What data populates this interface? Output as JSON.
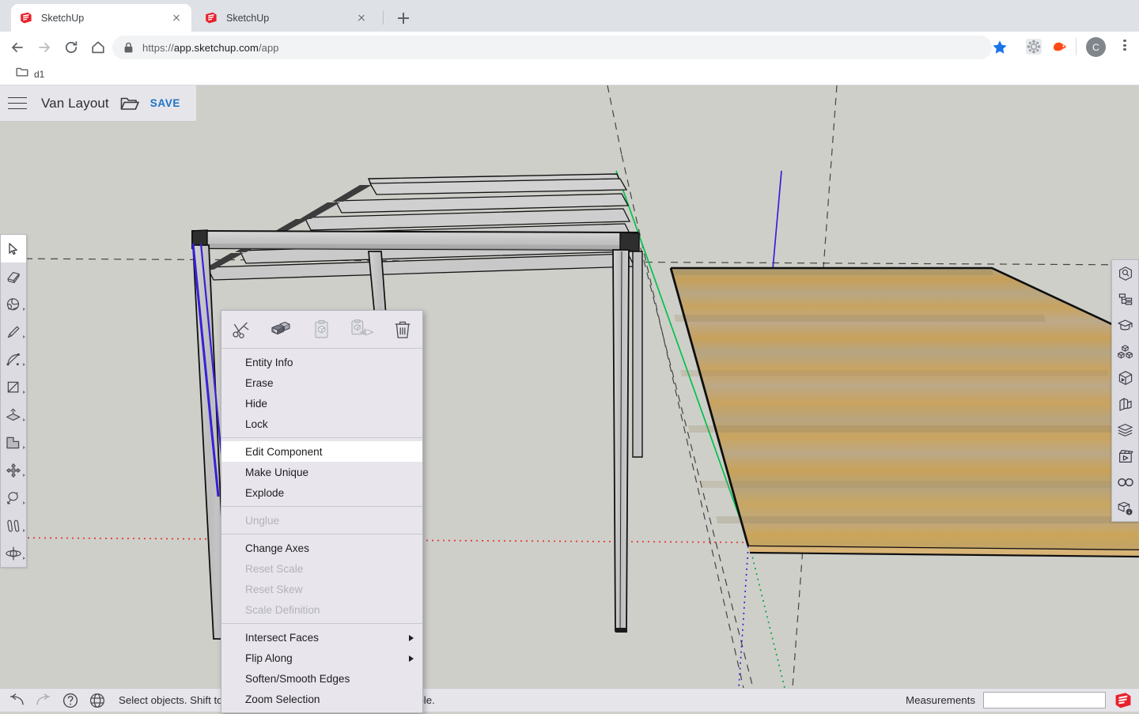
{
  "browser": {
    "tabs": [
      {
        "title": "SketchUp",
        "active": true,
        "favicon": "sketchup-icon"
      },
      {
        "title": "SketchUp",
        "active": false,
        "favicon": "sketchup-icon"
      }
    ],
    "new_tab_label": "+",
    "nav": {
      "back": "back-arrow",
      "forward": "forward-arrow",
      "reload": "reload-icon",
      "home": "home-icon"
    },
    "omnibox": {
      "lock": "lock-icon",
      "url_secure": "https://",
      "url_domain": "app.sketchup.com",
      "url_path": "/app",
      "full_url": "https://app.sketchup.com/app"
    },
    "toolbar_right": {
      "bookmark_star": "star-icon",
      "extension_puzzle": "extension-icon",
      "extension_accent": "extension-icon",
      "profile_initial": "C",
      "menu": "kebab-menu-icon"
    },
    "bookmarks": [
      {
        "label": "d1",
        "icon": "folder-icon"
      }
    ]
  },
  "app_header": {
    "menu_icon": "hamburger-icon",
    "document_title": "Van Layout",
    "folder_icon": "folder-open-icon",
    "save_label": "SAVE"
  },
  "left_toolbar": {
    "tools": [
      {
        "name": "select-tool",
        "icon": "cursor-arrow-icon",
        "active": true,
        "has_flyout": false
      },
      {
        "name": "eraser-tool",
        "icon": "eraser-icon",
        "active": false,
        "has_flyout": false
      },
      {
        "name": "paint-tool",
        "icon": "paint-bucket-icon",
        "active": false,
        "has_flyout": true
      },
      {
        "name": "line-tool",
        "icon": "pencil-icon",
        "active": false,
        "has_flyout": true
      },
      {
        "name": "arc-tool",
        "icon": "arc-icon",
        "active": false,
        "has_flyout": true
      },
      {
        "name": "rectangle-tool",
        "icon": "rectangle-icon",
        "active": false,
        "has_flyout": true
      },
      {
        "name": "pushpull-tool",
        "icon": "push-pull-icon",
        "active": false,
        "has_flyout": true
      },
      {
        "name": "offset-tool",
        "icon": "offset-icon",
        "active": false,
        "has_flyout": true
      },
      {
        "name": "move-tool",
        "icon": "move-icon",
        "active": false,
        "has_flyout": true
      },
      {
        "name": "rotate-tool",
        "icon": "rotate-icon",
        "active": false,
        "has_flyout": true
      },
      {
        "name": "tape-measure-tool",
        "icon": "tape-measure-icon",
        "active": false,
        "has_flyout": true
      },
      {
        "name": "orbit-tool",
        "icon": "orbit-icon",
        "active": false,
        "has_flyout": true
      }
    ]
  },
  "right_toolbar": {
    "panels": [
      {
        "name": "entity-info-panel",
        "icon": "entity-info-icon"
      },
      {
        "name": "outliner-panel",
        "icon": "outliner-icon"
      },
      {
        "name": "instructor-panel",
        "icon": "graduation-cap-icon"
      },
      {
        "name": "components-panel",
        "icon": "components-icon"
      },
      {
        "name": "materials-panel",
        "icon": "materials-cube-icon"
      },
      {
        "name": "styles-panel",
        "icon": "styles-icon"
      },
      {
        "name": "tags-panel",
        "icon": "layers-stack-icon"
      },
      {
        "name": "scenes-panel",
        "icon": "scenes-film-icon"
      },
      {
        "name": "display-panel",
        "icon": "glasses-icon"
      },
      {
        "name": "model-info-panel",
        "icon": "model-info-icon"
      }
    ]
  },
  "context_menu": {
    "toolbar_icons": [
      {
        "name": "cut-icon",
        "enabled": true
      },
      {
        "name": "copy-icon",
        "enabled": true
      },
      {
        "name": "paste-icon",
        "enabled": false
      },
      {
        "name": "paste-in-place-icon",
        "enabled": false
      },
      {
        "name": "delete-trash-icon",
        "enabled": true
      }
    ],
    "groups": [
      {
        "items": [
          {
            "label": "Entity Info",
            "enabled": true,
            "highlighted": false,
            "submenu": false
          },
          {
            "label": "Erase",
            "enabled": true,
            "highlighted": false,
            "submenu": false
          },
          {
            "label": "Hide",
            "enabled": true,
            "highlighted": false,
            "submenu": false
          },
          {
            "label": "Lock",
            "enabled": true,
            "highlighted": false,
            "submenu": false
          }
        ]
      },
      {
        "items": [
          {
            "label": "Edit Component",
            "enabled": true,
            "highlighted": true,
            "submenu": false
          },
          {
            "label": "Make Unique",
            "enabled": true,
            "highlighted": false,
            "submenu": false
          },
          {
            "label": "Explode",
            "enabled": true,
            "highlighted": false,
            "submenu": false
          }
        ]
      },
      {
        "items": [
          {
            "label": "Unglue",
            "enabled": false,
            "highlighted": false,
            "submenu": false
          }
        ]
      },
      {
        "items": [
          {
            "label": "Change Axes",
            "enabled": true,
            "highlighted": false,
            "submenu": false
          },
          {
            "label": "Reset Scale",
            "enabled": false,
            "highlighted": false,
            "submenu": false
          },
          {
            "label": "Reset Skew",
            "enabled": false,
            "highlighted": false,
            "submenu": false
          },
          {
            "label": "Scale Definition",
            "enabled": false,
            "highlighted": false,
            "submenu": false
          }
        ]
      },
      {
        "items": [
          {
            "label": "Intersect Faces",
            "enabled": true,
            "highlighted": false,
            "submenu": true
          },
          {
            "label": "Flip Along",
            "enabled": true,
            "highlighted": false,
            "submenu": true
          },
          {
            "label": "Soften/Smooth Edges",
            "enabled": true,
            "highlighted": false,
            "submenu": false
          },
          {
            "label": "Zoom Selection",
            "enabled": true,
            "highlighted": false,
            "submenu": false
          }
        ]
      }
    ]
  },
  "status_bar": {
    "icons": [
      {
        "name": "undo-icon"
      },
      {
        "name": "redo-icon"
      },
      {
        "name": "help-icon"
      },
      {
        "name": "globe-icon"
      }
    ],
    "message": "Select objects. Shift to extend select. Drag mouse to select multiple.",
    "measurements_label": "Measurements",
    "measurements_value": "",
    "measurements_placeholder": "",
    "logo": "sketchup-logo-icon"
  },
  "viewport": {
    "background_color": "#cfcfca",
    "axes": {
      "red_axis_color": "#e2352c",
      "green_axis_color": "#00c24a",
      "blue_axis_color": "#3720d8"
    },
    "model": {
      "structure_name": "pergola-frame",
      "beam_color": "#c9c9c9",
      "beam_shadow_color": "#3a3a3a",
      "floor_name": "wood-deck",
      "floor_color": "#c09a5e"
    }
  }
}
